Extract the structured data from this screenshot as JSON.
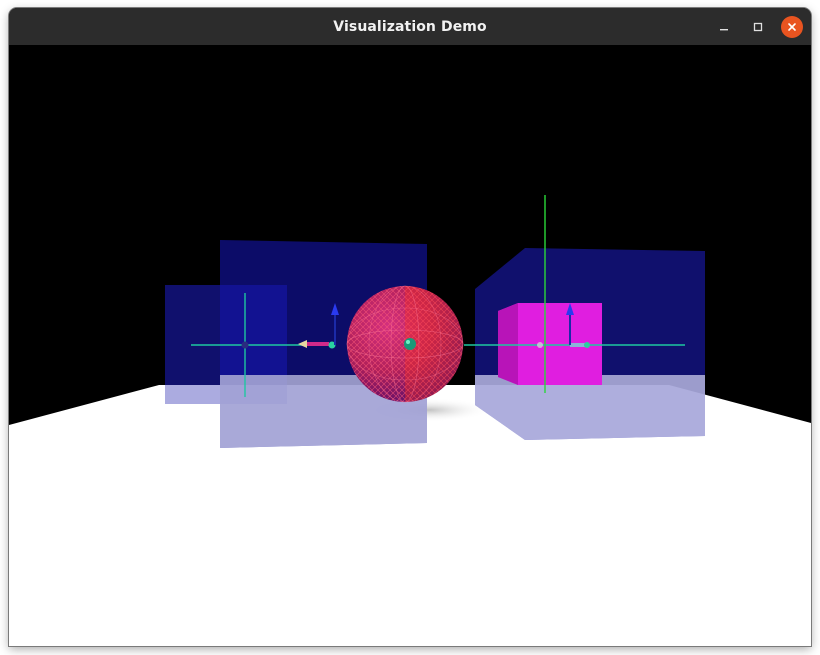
{
  "window": {
    "title": "Visualization Demo",
    "controls": {
      "minimize_icon": "minimize-icon",
      "maximize_icon": "maximize-icon",
      "close_icon": "close-icon",
      "close_color": "#e95420"
    }
  },
  "scene": {
    "background_color": "#000000",
    "ground_color": "#ffffff",
    "objects": [
      {
        "kind": "translucent-box",
        "color": "#1a1aa0"
      },
      {
        "kind": "translucent-box",
        "color": "#1a1aa0"
      },
      {
        "kind": "translucent-box",
        "color": "#1a1aa0"
      },
      {
        "kind": "solid-box",
        "color": "#e21ee0"
      },
      {
        "kind": "wireframe-sphere",
        "color": "#c8224e"
      },
      {
        "kind": "axis-gizmo",
        "color": "#1ec8a0"
      },
      {
        "kind": "axis-gizmo",
        "color": "#1ec8a0"
      }
    ]
  }
}
